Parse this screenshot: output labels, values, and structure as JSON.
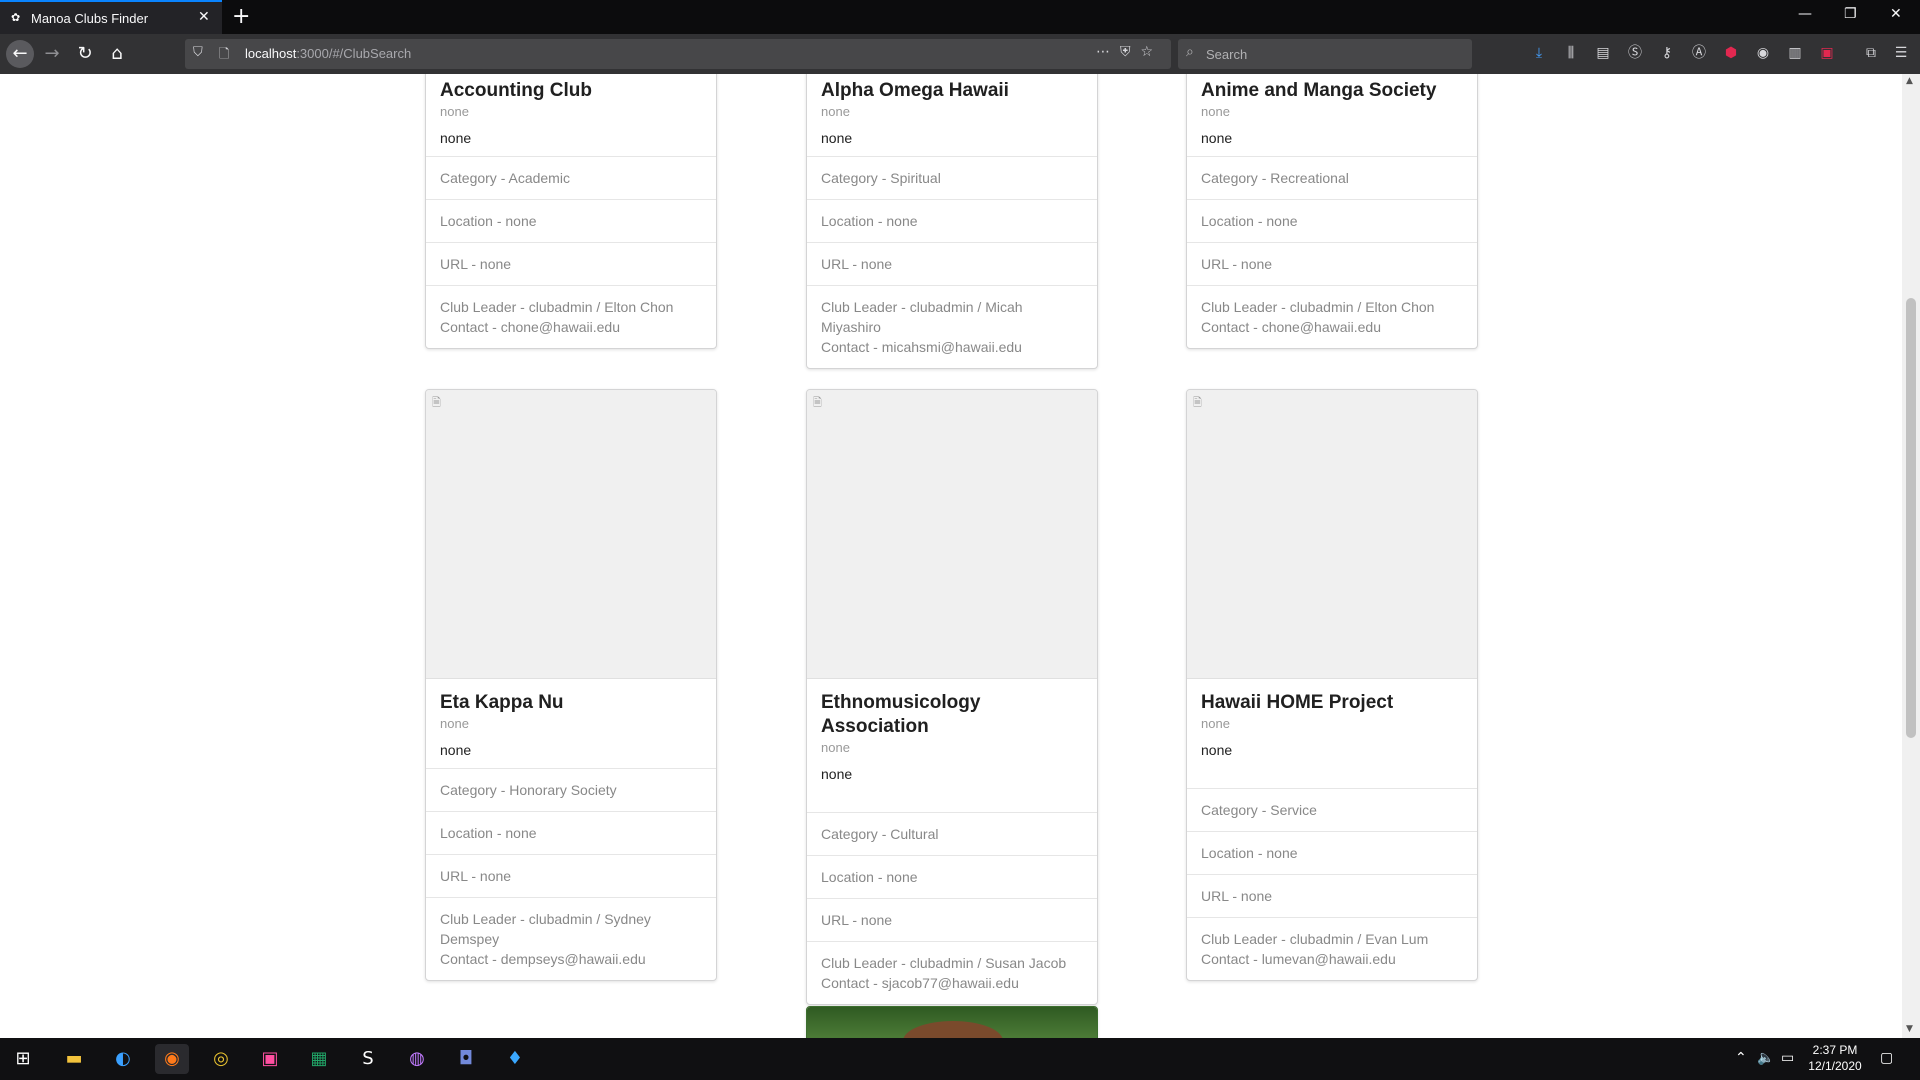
{
  "browser": {
    "tab_title": "Manoa Clubs Finder",
    "tab_favicon": "manoa-favicon",
    "url_host": "localhost",
    "url_path": ":3000/#/ClubSearch",
    "search_placeholder": "Search",
    "new_tab": "+",
    "close_tab": "✕",
    "accent_color": "#0a84ff"
  },
  "clubs": [
    {
      "name": "Accounting Club",
      "type": "none",
      "description": "none",
      "category": "Category - Academic",
      "location": "Location - none",
      "url": "URL - none",
      "leader": "Club Leader - clubadmin / Elton Chon",
      "contact": "Contact - chone@hawaii.edu"
    },
    {
      "name": "Alpha Omega Hawaii",
      "type": "none",
      "description": "none",
      "category": "Category - Spiritual",
      "location": "Location - none",
      "url": "URL - none",
      "leader": "Club Leader - clubadmin / Micah Miyashiro",
      "contact": "Contact - micahsmi@hawaii.edu"
    },
    {
      "name": "Anime and Manga Society",
      "type": "none",
      "description": "none",
      "category": "Category - Recreational",
      "location": "Location - none",
      "url": "URL - none",
      "leader": "Club Leader - clubadmin / Elton Chon",
      "contact": "Contact - chone@hawaii.edu"
    },
    {
      "name": "Eta Kappa Nu",
      "type": "none",
      "description": "none",
      "category": "Category - Honorary Society",
      "location": "Location - none",
      "url": "URL - none",
      "leader": "Club Leader - clubadmin / Sydney Demspey",
      "contact": "Contact - dempseys@hawaii.edu"
    },
    {
      "name": "Ethnomusicology Association",
      "type": "none",
      "description": "none",
      "category": "Category - Cultural",
      "location": "Location - none",
      "url": "URL - none",
      "leader": "Club Leader - clubadmin / Susan Jacob",
      "contact": "Contact - sjacob77@hawaii.edu"
    },
    {
      "name": "Hawaii HOME Project",
      "type": "none",
      "description": "none",
      "category": "Category - Service",
      "location": "Location - none",
      "url": "URL - none",
      "leader": "Club Leader - clubadmin / Evan Lum",
      "contact": "Contact - lumevan@hawaii.edu"
    }
  ],
  "taskbar": {
    "time": "2:37 PM",
    "date": "12/1/2020",
    "apps": [
      "windows-start-icon",
      "file-explorer-icon",
      "edge-icon",
      "firefox-icon",
      "chrome-icon",
      "intellij-icon",
      "excel-icon",
      "s-app-icon",
      "media-app-icon",
      "discord-icon",
      "dropper-app-icon"
    ]
  }
}
